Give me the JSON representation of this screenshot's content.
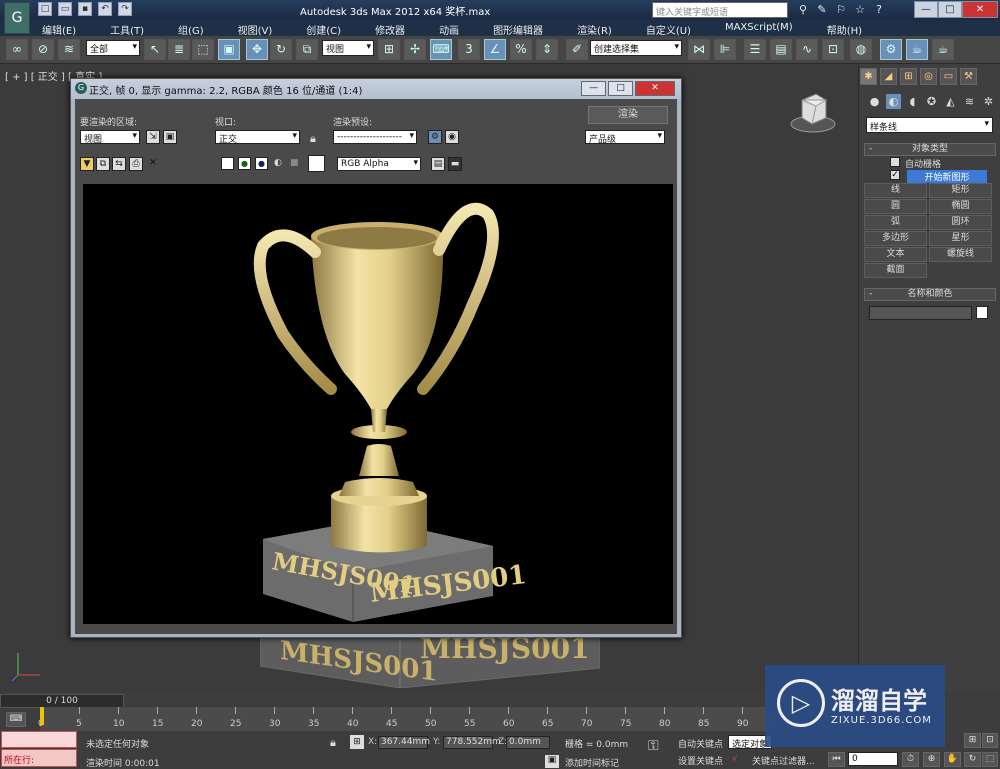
{
  "app": {
    "title": "Autodesk 3ds Max  2012 x64    奖杯.max",
    "search_placeholder": "键入关键字或短语"
  },
  "menus": [
    "编辑(E)",
    "工具(T)",
    "组(G)",
    "视图(V)",
    "创建(C)",
    "修改器",
    "动画",
    "图形编辑器",
    "渲染(R)",
    "自定义(U)",
    "MAXScript(M)",
    "帮助(H)"
  ],
  "toolbar": {
    "selection_filter": "全部",
    "ref_coord": "视图",
    "named_selection": "创建选择集"
  },
  "viewport": {
    "label": "[ + ] [ 正交 ] [ 真实 ]",
    "trophy_text": "MHSJS001"
  },
  "render_window": {
    "title": "正交, 帧 0, 显示 gamma: 2.2, RGBA 颜色 16 位/通道 (1:4)",
    "area_label": "要渲染的区域:",
    "area_value": "视图",
    "viewport_label": "视口:",
    "viewport_value": "正交",
    "preset_label": "渲染预设:",
    "preset_value": "--------------------",
    "render_button": "渲染",
    "quality_value": "产品级",
    "channel_value": "RGB Alpha",
    "trophy_text_left": "MHSJS001",
    "trophy_text_right": "MHSJS001"
  },
  "command_panel": {
    "dropdown": "样条线",
    "object_type_header": "对象类型",
    "autogrid_label": "自动栅格",
    "start_new_shape_label": "开始新图形",
    "buttons": [
      "线",
      "矩形",
      "圆",
      "椭圆",
      "弧",
      "圆环",
      "多边形",
      "星形",
      "文本",
      "螺旋线",
      "截面"
    ],
    "name_color_header": "名称和颜色"
  },
  "timeline": {
    "slider": "0 / 100",
    "ticks": [
      "0",
      "5",
      "10",
      "15",
      "20",
      "25",
      "30",
      "35",
      "40",
      "45",
      "50",
      "55",
      "60",
      "65",
      "70",
      "75",
      "80",
      "85",
      "90"
    ]
  },
  "status": {
    "running": "所在行:",
    "selection": "未选定任何对象",
    "render_time": "渲染时间  0:00:01",
    "x_label": "X:",
    "x_value": "367.44mm",
    "y_label": "Y:",
    "y_value": "778.552mm",
    "z_label": "Z:",
    "z_value": "0.0mm",
    "grid": "栅格 = 0.0mm",
    "add_time_tag": "添加时间标记",
    "auto_key": "自动关键点",
    "selected_object": "选定对象",
    "set_key": "设置关键点",
    "key_filters": "关键点过滤器...",
    "frame_value": "0"
  },
  "watermark": {
    "brand": "溜溜自学",
    "url": "ZIXUE.3D66.COM"
  },
  "colors": {
    "titlebar": "#263d5c",
    "accent": "#3c7ad6",
    "gold": "#e6d28a"
  }
}
